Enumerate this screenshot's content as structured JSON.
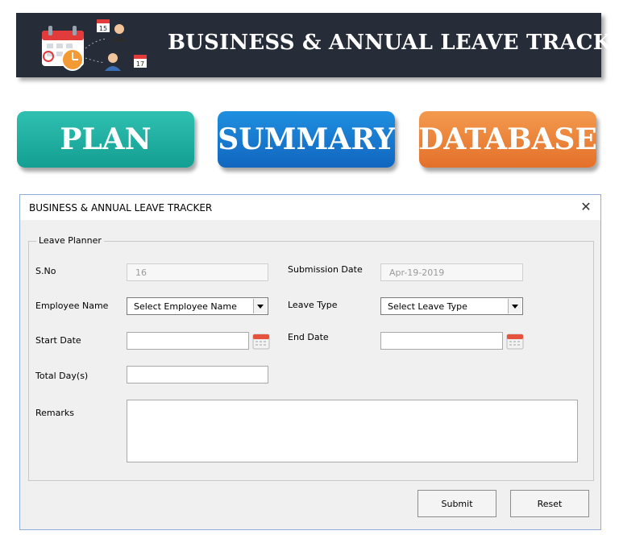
{
  "banner": {
    "title": "BUSINESS & ANNUAL LEAVE TRACKER"
  },
  "nav": [
    {
      "label": "PLAN"
    },
    {
      "label": "SUMMARY"
    },
    {
      "label": "DATABASE"
    }
  ],
  "dialog": {
    "title": "BUSINESS & ANNUAL LEAVE TRACKER",
    "close_glyph": "✕",
    "group_label": "Leave Planner",
    "fields": {
      "sno": {
        "label": "S.No",
        "value": "16"
      },
      "submission_date": {
        "label": "Submission Date",
        "value": "Apr-19-2019"
      },
      "employee_name": {
        "label": "Employee Name",
        "value": "Select Employee Name"
      },
      "leave_type": {
        "label": "Leave Type",
        "value": "Select Leave Type"
      },
      "start_date": {
        "label": "Start Date",
        "value": ""
      },
      "end_date": {
        "label": "End Date",
        "value": ""
      },
      "total_days": {
        "label": "Total Day(s)",
        "value": ""
      },
      "remarks": {
        "label": "Remarks",
        "value": ""
      }
    },
    "buttons": {
      "submit": "Submit",
      "reset": "Reset"
    }
  },
  "colors": {
    "banner_bg": "#262c38",
    "plan": "#1fae9f",
    "summary": "#1a78cf",
    "database": "#ea8037"
  }
}
